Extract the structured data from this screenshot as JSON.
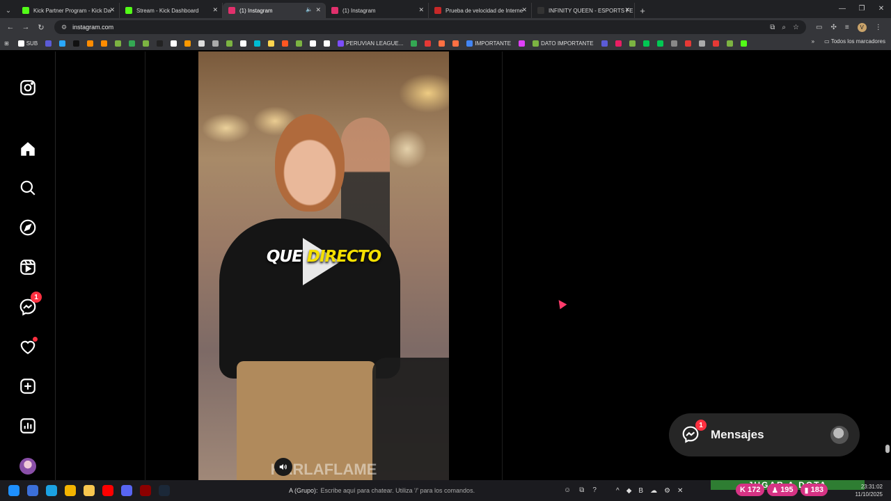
{
  "browser": {
    "tabs": [
      {
        "title": "Kick Partner Program - Kick Da",
        "favicon_color": "#53fc18",
        "active": false
      },
      {
        "title": "Stream - Kick Dashboard",
        "favicon_color": "#53fc18",
        "active": false
      },
      {
        "title": "(1) Instagram",
        "favicon_color": "#e1306c",
        "active": true,
        "audio": true
      },
      {
        "title": "(1) Instagram",
        "favicon_color": "#e1306c",
        "active": false
      },
      {
        "title": "Prueba de velocidad de Interne",
        "favicon_color": "#c62828",
        "active": false
      },
      {
        "title": "INFINITY QUEEN - ESPORTS FE",
        "favicon_color": "#333333",
        "active": false
      }
    ],
    "url": "instagram.com",
    "bookmarks": [
      {
        "label": "SUB",
        "color": "#ffffff"
      },
      {
        "label": "",
        "color": "#5b5bd6"
      },
      {
        "label": "",
        "color": "#2aa8ff"
      },
      {
        "label": "",
        "color": "#111111"
      },
      {
        "label": "",
        "color": "#ff8c00"
      },
      {
        "label": "",
        "color": "#ff8c00"
      },
      {
        "label": "",
        "color": "#7cb342"
      },
      {
        "label": "",
        "color": "#34a853"
      },
      {
        "label": "",
        "color": "#7cb342"
      },
      {
        "label": "",
        "color": "#222222"
      },
      {
        "label": "",
        "color": "#ffffff"
      },
      {
        "label": "",
        "color": "#ff9900"
      },
      {
        "label": "",
        "color": "#dddddd"
      },
      {
        "label": "",
        "color": "#aaaaaa"
      },
      {
        "label": "",
        "color": "#7cb342"
      },
      {
        "label": "",
        "color": "#ffffff"
      },
      {
        "label": "",
        "color": "#00bcd4"
      },
      {
        "label": "",
        "color": "#ffd54f"
      },
      {
        "label": "",
        "color": "#ff5722"
      },
      {
        "label": "",
        "color": "#7cb342"
      },
      {
        "label": "",
        "color": "#ffffff"
      },
      {
        "label": "",
        "color": "#ffffff"
      },
      {
        "label": "PERUVIAN LEAGUE...",
        "color": "#7c4dff"
      },
      {
        "label": "",
        "color": "#34a853"
      },
      {
        "label": "",
        "color": "#e53935"
      },
      {
        "label": "",
        "color": "#ff7043"
      },
      {
        "label": "",
        "color": "#ff7043"
      },
      {
        "label": "IMPORTANTE",
        "color": "#4285f4"
      },
      {
        "label": "",
        "color": "#e040fb"
      },
      {
        "label": "DATO IMPORTANTE",
        "color": "#7cb342"
      },
      {
        "label": "",
        "color": "#5b5bd6"
      },
      {
        "label": "",
        "color": "#e91e63"
      },
      {
        "label": "",
        "color": "#7cb342"
      },
      {
        "label": "",
        "color": "#00c853"
      },
      {
        "label": "",
        "color": "#00c853"
      },
      {
        "label": "",
        "color": "#888888"
      },
      {
        "label": "",
        "color": "#e53935"
      },
      {
        "label": "",
        "color": "#aaaaaa"
      },
      {
        "label": "",
        "color": "#e53935"
      },
      {
        "label": "",
        "color": "#7cb342"
      },
      {
        "label": "",
        "color": "#53fc18"
      }
    ],
    "all_bookmarks_label": "Todos los marcadores"
  },
  "sidebar": {
    "items": [
      {
        "name": "instagram-logo-icon"
      },
      {
        "name": "home-icon"
      },
      {
        "name": "search-icon"
      },
      {
        "name": "explore-icon"
      },
      {
        "name": "reels-icon"
      },
      {
        "name": "messenger-icon",
        "badge": "1"
      },
      {
        "name": "notifications-icon",
        "dot": true
      },
      {
        "name": "create-icon"
      },
      {
        "name": "dashboard-icon"
      },
      {
        "name": "profile-avatar"
      }
    ]
  },
  "reel": {
    "caption_white": "QUE",
    "caption_yellow": "DIRECTO",
    "watermark": "KARLAFLAME"
  },
  "messages": {
    "label": "Mensajes",
    "badge": "1"
  },
  "game_overlay": {
    "chat_group": "A (Grupo):",
    "chat_placeholder": "Escribe aquí para chatear. Utiliza '/' para los comandos.",
    "banner": "JUGAR A DOTA",
    "stats": [
      {
        "value": "172",
        "icon": "kick-icon"
      },
      {
        "value": "195",
        "icon": "user-icon"
      },
      {
        "value": "183",
        "icon": "bars-icon"
      }
    ]
  },
  "taskbar": {
    "apps": [
      {
        "name": "windows-start",
        "color": "#1e90ff"
      },
      {
        "name": "app-2",
        "color": "#3b6fd8"
      },
      {
        "name": "edge",
        "color": "#1ba1e2"
      },
      {
        "name": "chrome",
        "color": "#f4b400"
      },
      {
        "name": "explorer",
        "color": "#f9c74f"
      },
      {
        "name": "youtube",
        "color": "#ff0000"
      },
      {
        "name": "discord",
        "color": "#5865f2"
      },
      {
        "name": "app-8",
        "color": "#8b0000"
      },
      {
        "name": "steam",
        "color": "#1b2838"
      }
    ],
    "time": "23:31:02",
    "date": "11/10/2025"
  }
}
